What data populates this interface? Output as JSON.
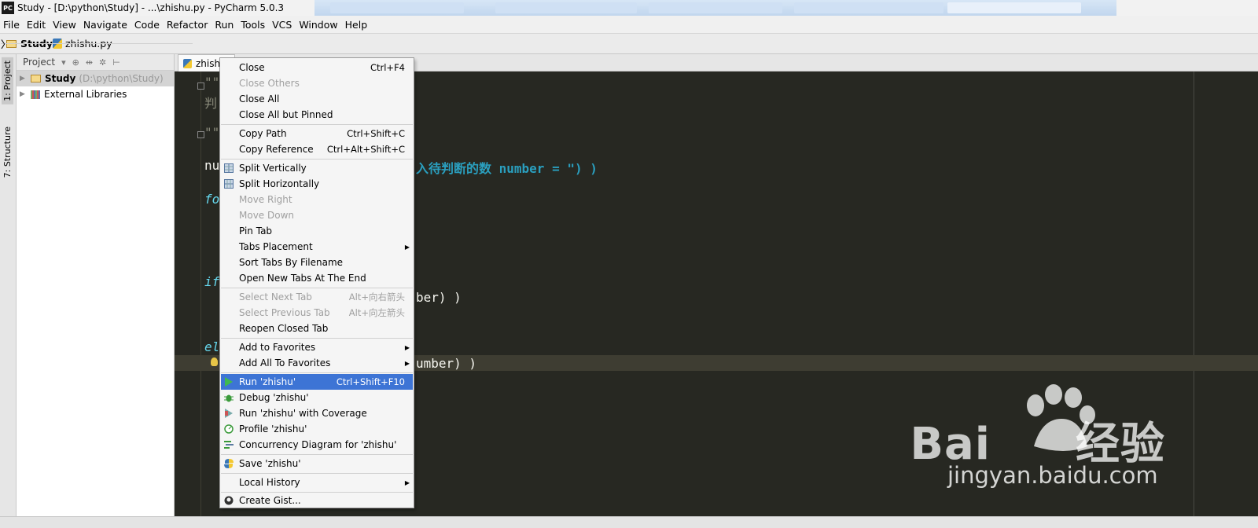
{
  "window": {
    "title": "Study - [D:\\python\\Study] - ...\\zhishu.py - PyCharm 5.0.3",
    "app_icon": "PC"
  },
  "menubar": [
    "File",
    "Edit",
    "View",
    "Navigate",
    "Code",
    "Refactor",
    "Run",
    "Tools",
    "VCS",
    "Window",
    "Help"
  ],
  "breadcrumb": {
    "project": "Study",
    "file": "zhishu.py"
  },
  "toolstrip": {
    "project_tab": "1: Project",
    "structure_tab": "7: Structure"
  },
  "project_panel": {
    "header": "Project",
    "tree": [
      {
        "label": "Study",
        "path": "(D:\\python\\Study)"
      },
      {
        "label": "External Libraries"
      }
    ]
  },
  "editor": {
    "tab_label": "zhishu",
    "code": {
      "l1": "\"\"",
      "l2": "判",
      "l3": "\"\"",
      "l4a": "nu",
      "l4b": "入待判断的数 number = \") )",
      "l5": "fo",
      "l6": "if",
      "l7": "ber) )",
      "l8": "el",
      "l9": "umber) )"
    }
  },
  "context_menu": {
    "items": {
      "close": {
        "label": "Close",
        "shortcut": "Ctrl+F4"
      },
      "close_others": {
        "label": "Close Others"
      },
      "close_all": {
        "label": "Close All"
      },
      "close_all_but_pinned": {
        "label": "Close All but Pinned"
      },
      "copy_path": {
        "label": "Copy Path",
        "shortcut": "Ctrl+Shift+C"
      },
      "copy_reference": {
        "label": "Copy Reference",
        "shortcut": "Ctrl+Alt+Shift+C"
      },
      "split_vertically": {
        "label": "Split Vertically"
      },
      "split_horizontally": {
        "label": "Split Horizontally"
      },
      "move_right": {
        "label": "Move Right"
      },
      "move_down": {
        "label": "Move Down"
      },
      "pin_tab": {
        "label": "Pin Tab"
      },
      "tabs_placement": {
        "label": "Tabs Placement"
      },
      "sort_tabs": {
        "label": "Sort Tabs By Filename"
      },
      "open_new_tabs_end": {
        "label": "Open New Tabs At The End"
      },
      "select_next_tab": {
        "label": "Select Next Tab",
        "shortcut": "Alt+向右箭头"
      },
      "select_prev_tab": {
        "label": "Select Previous Tab",
        "shortcut": "Alt+向左箭头"
      },
      "reopen_closed_tab": {
        "label": "Reopen Closed Tab"
      },
      "add_to_favorites": {
        "label": "Add to Favorites"
      },
      "add_all_to_favorites": {
        "label": "Add All To Favorites"
      },
      "run": {
        "label": "Run 'zhishu'",
        "shortcut": "Ctrl+Shift+F10"
      },
      "debug": {
        "label": "Debug 'zhishu'"
      },
      "run_coverage": {
        "label": "Run 'zhishu' with Coverage"
      },
      "profile": {
        "label": "Profile 'zhishu'"
      },
      "concurrency": {
        "label": "Concurrency Diagram for  'zhishu'"
      },
      "save": {
        "label": "Save 'zhishu'"
      },
      "local_history": {
        "label": "Local History"
      },
      "create_gist": {
        "label": "Create Gist..."
      }
    }
  },
  "watermark": {
    "brand": "Bai",
    "brand_suffix": "经验",
    "url": "jingyan.baidu.com"
  },
  "colors": {
    "editor_bg": "#272822",
    "menu_highlight": "#3d74d5",
    "keyword": "#66d9ef"
  }
}
